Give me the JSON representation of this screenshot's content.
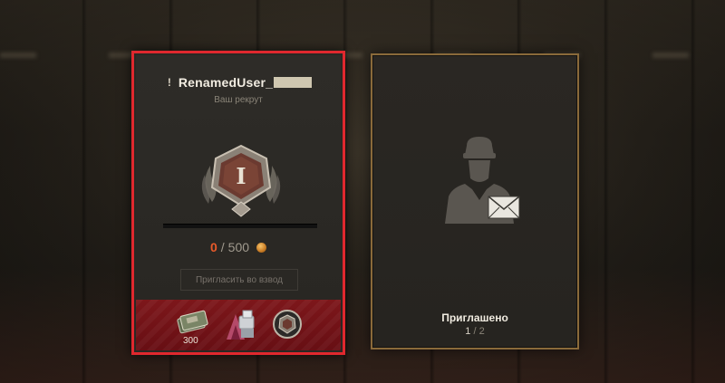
{
  "recruit": {
    "username": "RenamedUser_",
    "subtitle": "Ваш рекрут",
    "rank_numeral": "I",
    "points_current": "0",
    "points_separator": "/",
    "points_total": "500",
    "progress_fraction": 0,
    "invite_button_label": "Пригласить во взвод",
    "rewards": [
      {
        "icon": "credits-icon",
        "count": "300"
      },
      {
        "icon": "personal-mission-icon"
      },
      {
        "icon": "rank-badge-icon"
      }
    ]
  },
  "invited": {
    "label": "Приглашено",
    "current": "1",
    "separator": "/",
    "total": "2"
  },
  "colors": {
    "highlight_border": "#e0282e",
    "points_current": "#e85a2a",
    "card_border_gold": "#8a6a3a"
  }
}
